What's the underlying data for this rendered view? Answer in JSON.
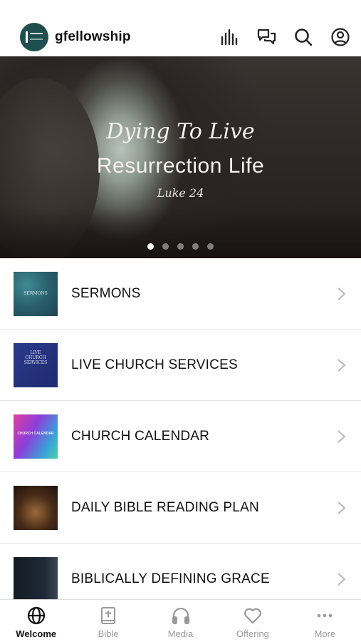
{
  "header": {
    "app_name": "gfellowship",
    "icons": [
      "stats-icon",
      "chat-icon",
      "search-icon",
      "profile-icon"
    ]
  },
  "hero": {
    "line1": "Dying To Live",
    "line2": "Resurrection Life",
    "line3": "Luke 24",
    "slide_count": 5,
    "active_slide": 1
  },
  "list": {
    "items": [
      {
        "label": "SERMONS",
        "thumb_text": "SERMONS"
      },
      {
        "label": "LIVE CHURCH SERVICES",
        "thumb_text": "LIVE CHURCH SERVICES"
      },
      {
        "label": "CHURCH CALENDAR",
        "thumb_text": "CHURCH CALENDAR"
      },
      {
        "label": "DAILY BIBLE READING PLAN",
        "thumb_text": ""
      },
      {
        "label": "BIBLICALLY DEFINING GRACE",
        "thumb_text": ""
      }
    ]
  },
  "tabbar": {
    "tabs": [
      {
        "label": "Welcome",
        "icon": "globe-icon",
        "active": true
      },
      {
        "label": "Bible",
        "icon": "bible-icon",
        "active": false
      },
      {
        "label": "Media",
        "icon": "headphones-icon",
        "active": false
      },
      {
        "label": "Offering",
        "icon": "heart-icon",
        "active": false
      },
      {
        "label": "More",
        "icon": "more-icon",
        "active": false
      }
    ]
  }
}
